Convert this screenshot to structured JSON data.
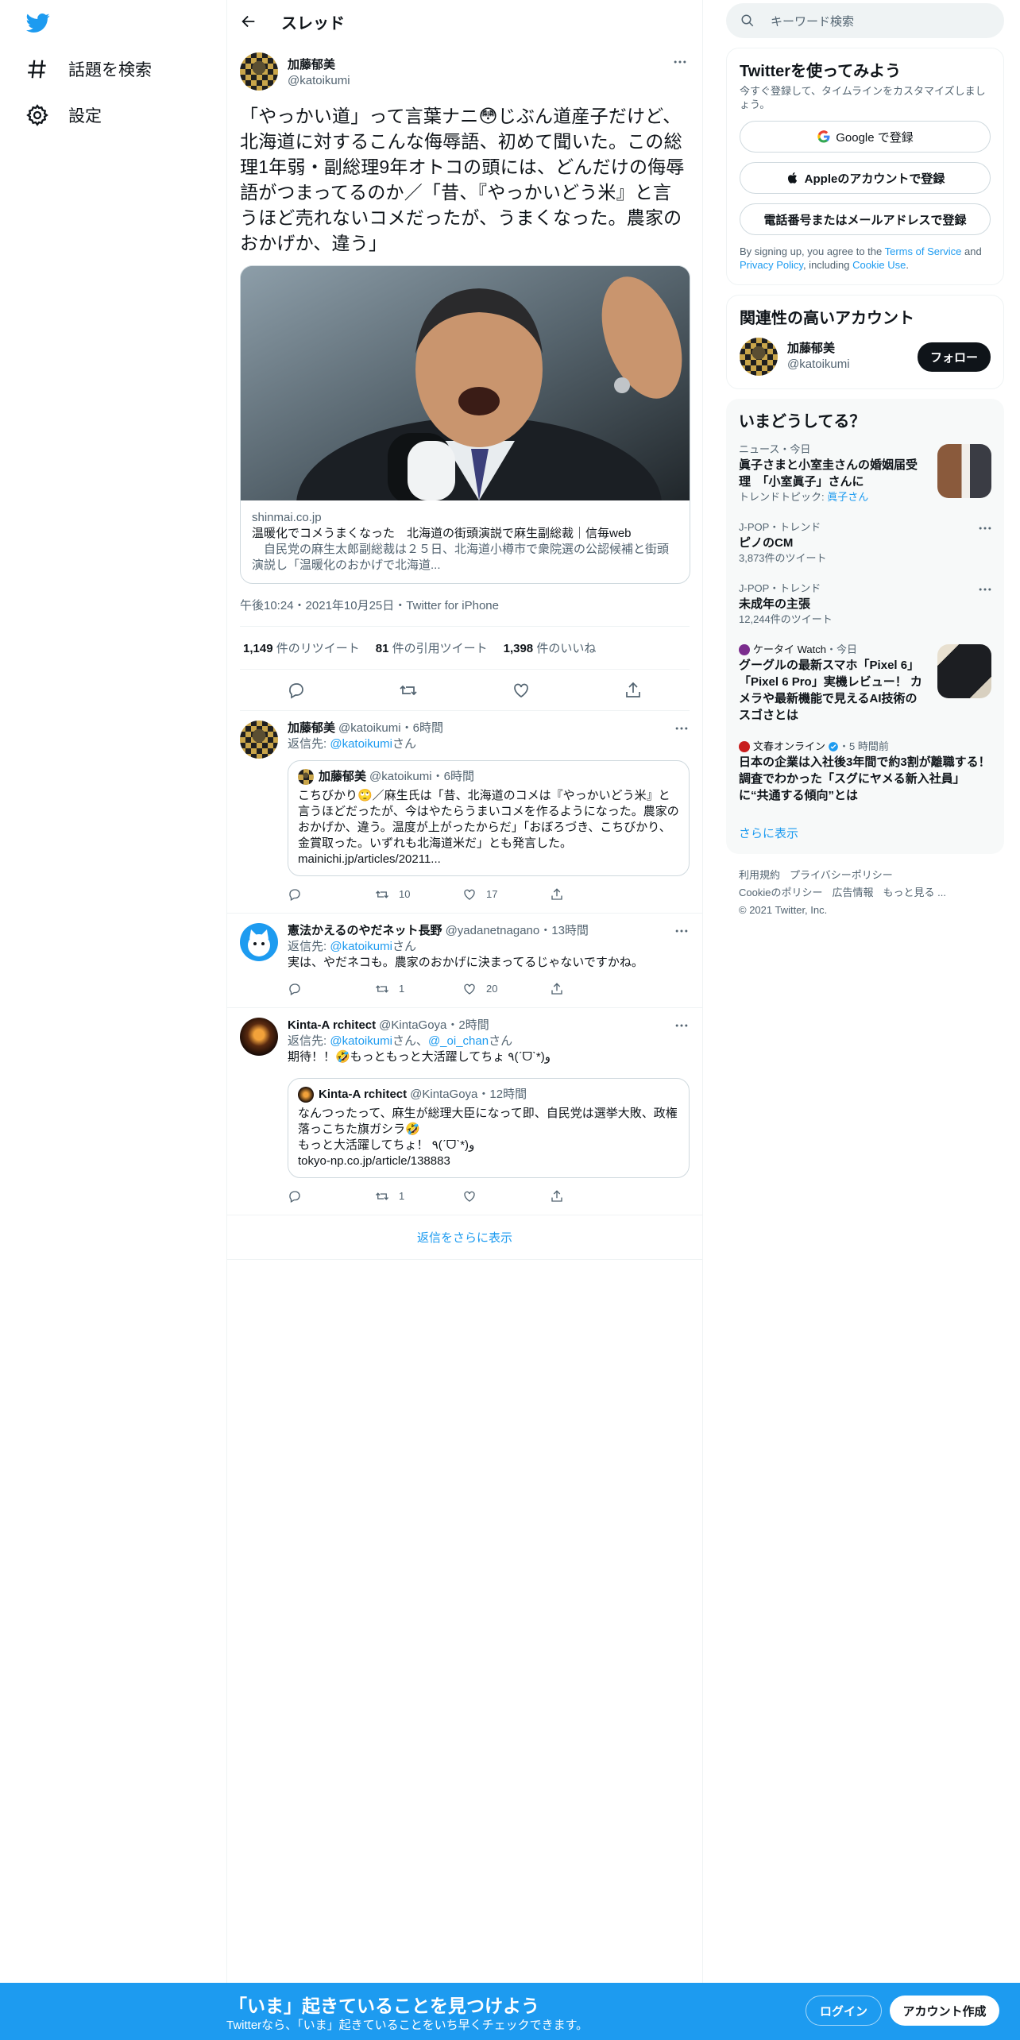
{
  "nav": {
    "explore": "話題を検索",
    "settings": "設定"
  },
  "header": {
    "title": "スレッド"
  },
  "main_tweet": {
    "name": "加藤郁美",
    "handle": "@katoikumi",
    "text": "「やっかい道」って言葉ナニ😳じぶん道産子だけど、北海道に対するこんな侮辱語、初めて聞いた。この総理1年弱・副総理9年オトコの頭には、どんだけの侮辱語がつまってるのか／「昔、『やっかいどう米』と言うほど売れないコメだったが、うまくなった。農家のおかげか、違う」",
    "card": {
      "domain": "shinmai.co.jp",
      "title": "温暖化でコメうまくなった　北海道の街頭演説で麻生副総裁｜信毎web",
      "desc": "　自民党の麻生太郎副総裁は２５日、北海道小樽市で衆院選の公認候補と街頭演説し「温暖化のおかげで北海道..."
    },
    "meta": "午後10:24・2021年10月25日・Twitter for iPhone",
    "stats": {
      "retweets": "1,149",
      "retweets_label": "件のリツイート",
      "quotes": "81",
      "quotes_label": "件の引用ツイート",
      "likes": "1,398",
      "likes_label": "件のいいね"
    }
  },
  "replies": [
    {
      "name": "加藤郁美",
      "handle": "@katoikumi",
      "time": "・6時間",
      "replyto_prefix": "返信先: ",
      "replyto": "@katoikumi",
      "replyto_suffix": "さん",
      "quote": {
        "name": "加藤郁美",
        "handle": "@katoikumi",
        "time": "・6時間",
        "text": "こちびかり🙄／麻生氏は「昔、北海道のコメは『やっかいどう米』と言うほどだったが、今はやたらうまいコメを作るようになった。農家のおかげか、違う。温度が上がったからだ」「おぼろづき、こちびかり、金賞取った。いずれも北海道米だ」とも発言した。mainichi.jp/articles/20211..."
      },
      "retweets": "10",
      "likes": "17"
    },
    {
      "name": "憲法かえるのやだネット長野",
      "handle": "@yadanetnagano",
      "time": "・13時間",
      "replyto_prefix": "返信先: ",
      "replyto": "@katoikumi",
      "replyto_suffix": "さん",
      "text": "実は、やだネコも。農家のおかげに決まってるじゃないですかね。",
      "retweets": "1",
      "likes": "20"
    },
    {
      "name": "Kinta-A rchitect",
      "handle": "@KintaGoya",
      "time": "・2時間",
      "replyto_prefix": "返信先: ",
      "replyto": "@katoikumi",
      "replyto_mid": "さん、",
      "replyto2": "@_oi_chan",
      "replyto_suffix": "さん",
      "text": "期待！！🤣もっともっと大活躍してちょ ٩(ˊᗜˋ*)و",
      "quote": {
        "name": "Kinta-A rchitect",
        "handle": "@KintaGoya",
        "time": "・12時間",
        "text": "なんつったって、麻生が総理大臣になって即、自民党は選挙大敗、政権落っこちた旗ガシラ🤣\nもっと大活躍してちょ！ ٩(ˊᗜˋ*)و\n tokyo-np.co.jp/article/138883"
      },
      "retweets": "1",
      "likes": ""
    }
  ],
  "show_more": "返信をさらに表示",
  "search": {
    "placeholder": "キーワード検索"
  },
  "signup_panel": {
    "title": "Twitterを使ってみよう",
    "sub": "今すぐ登録して、タイムラインをカスタマイズしましょう。",
    "google": "Google で登録",
    "apple": "Appleのアカウントで登録",
    "phone": "電話番号またはメールアドレスで登録",
    "terms_1": "By signing up, you agree to the ",
    "terms_tos": "Terms of Service",
    "terms_2": " and ",
    "terms_pp": "Privacy Policy",
    "terms_3": ", including ",
    "terms_cookie": "Cookie Use",
    "terms_4": "."
  },
  "related": {
    "title": "関連性の高いアカウント",
    "name": "加藤郁美",
    "handle": "@katoikumi",
    "follow": "フォロー"
  },
  "trends": {
    "title": "いまどうしてる？",
    "items": [
      {
        "cat": "ニュース・今日",
        "title": "眞子さまと小室圭さんの婚姻届受理　「小室眞子」さんに",
        "meta_prefix": "トレンドトピック: ",
        "meta_link": "眞子さん"
      },
      {
        "cat": "J-POP・トレンド",
        "title": "ピノのCM",
        "meta": "3,873件のツイート"
      },
      {
        "cat": "J-POP・トレンド",
        "title": "未成年の主張",
        "meta": "12,244件のツイート"
      },
      {
        "src": "ケータイ Watch",
        "time": "・今日",
        "title": "グーグルの最新スマホ「Pixel 6」「Pixel 6 Pro」実機レビュー！ カメラや最新機能で見えるAI技術のスゴさとは"
      },
      {
        "src": "文春オンライン",
        "time": "・5 時間前",
        "title": "日本の企業は入社後3年間で約3割が離職する！ 調査でわかった「スグにヤメる新入社員」に“共通する傾向”とは"
      }
    ],
    "more": "さらに表示"
  },
  "footer": {
    "l1": "利用規約",
    "l2": "プライバシーポリシー",
    "l3": "Cookieのポリシー",
    "l4": "広告情報",
    "l5": "もっと見る ...",
    "copy": "© 2021 Twitter, Inc."
  },
  "bottom": {
    "headline": "「いま」起きていることを見つけよう",
    "sub": "Twitterなら、「いま」起きていることをいち早くチェックできます。",
    "login": "ログイン",
    "signup": "アカウント作成"
  },
  "colors": {
    "accent": "#1d9bf0",
    "text": "#0f1419",
    "secondary": "#536471"
  }
}
